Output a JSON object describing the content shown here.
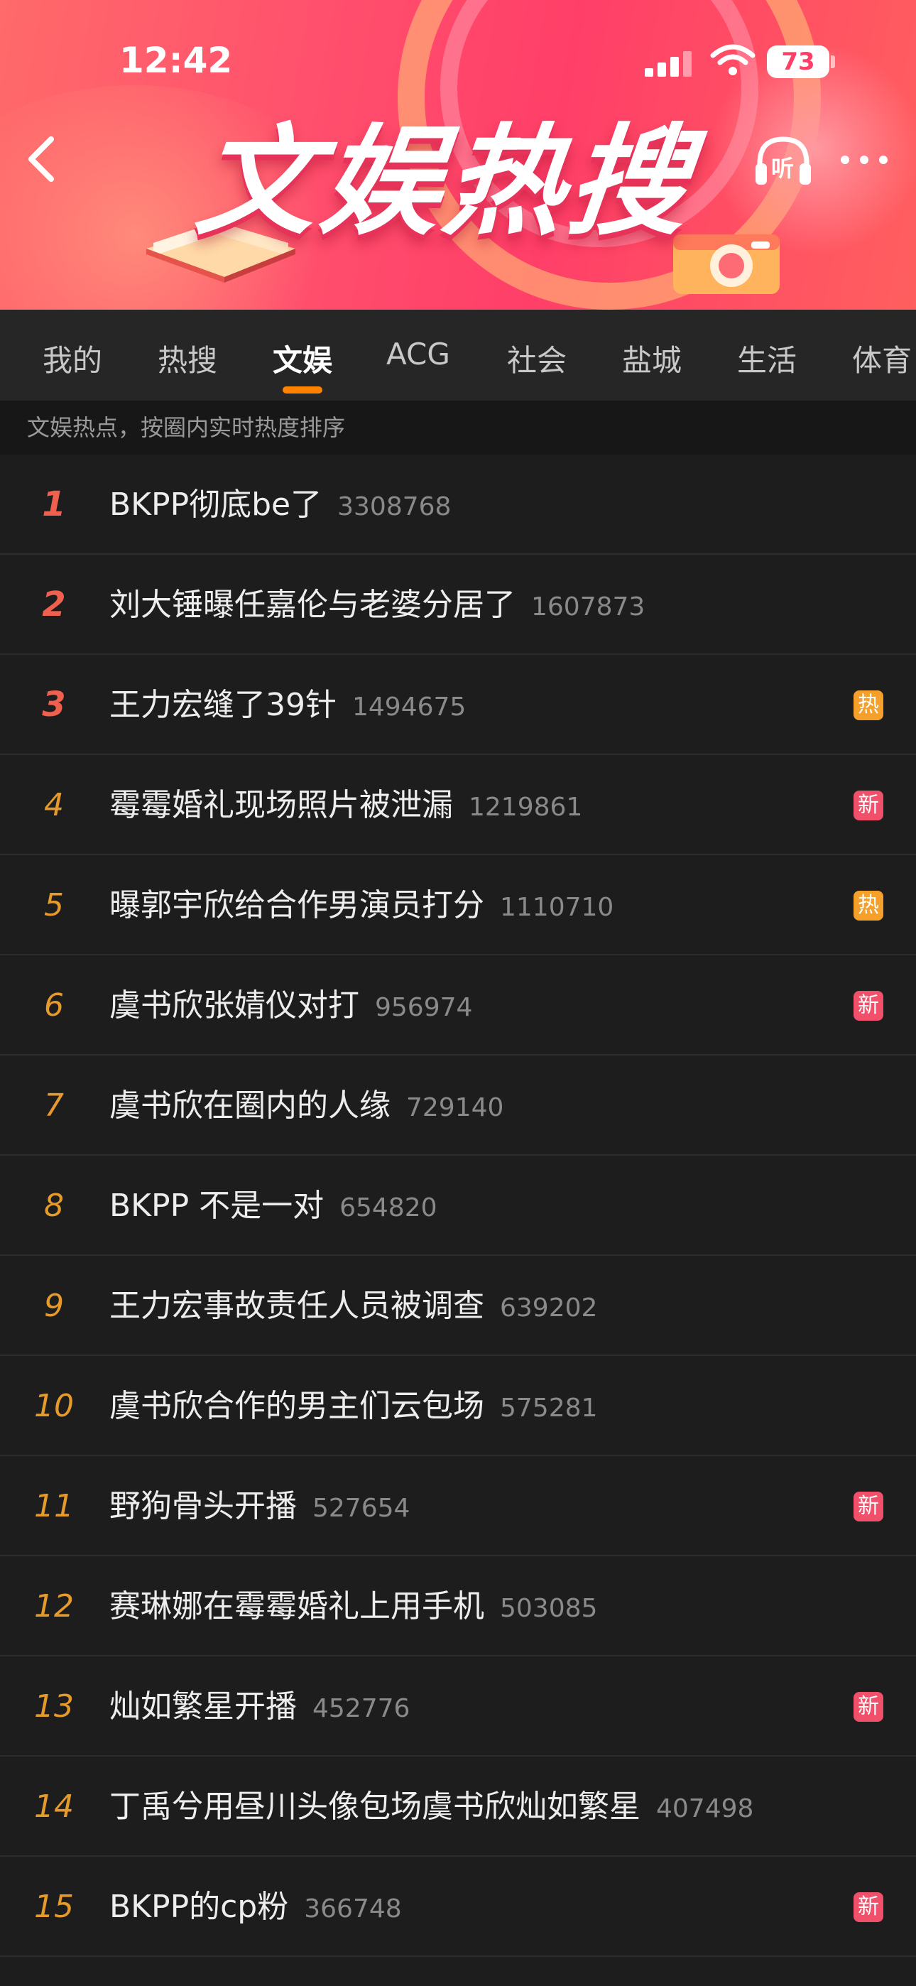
{
  "status_bar": {
    "time": "12:42",
    "battery": "73"
  },
  "header": {
    "title": "文娱热搜",
    "listen_label": "听"
  },
  "tabs": [
    {
      "label": "我的"
    },
    {
      "label": "热搜"
    },
    {
      "label": "文娱"
    },
    {
      "label": "ACG"
    },
    {
      "label": "社会"
    },
    {
      "label": "盐城"
    },
    {
      "label": "生活"
    },
    {
      "label": "体育"
    }
  ],
  "active_tab": "文娱",
  "subheader": "文娱热点，按圈内实时热度排序",
  "colors": {
    "accent": "#ff8200",
    "hot_badge": "#f5a02a",
    "new_badge": "#f0506a",
    "rank_top": "#f0604f",
    "rank": "#e69a2a"
  },
  "list": [
    {
      "rank": "1",
      "title": "BKPP彻底be了",
      "count": "3308768",
      "badge": ""
    },
    {
      "rank": "2",
      "title": "刘大锤曝任嘉伦与老婆分居了",
      "count": "1607873",
      "badge": ""
    },
    {
      "rank": "3",
      "title": "王力宏缝了39针",
      "count": "1494675",
      "badge": "热"
    },
    {
      "rank": "4",
      "title": "霉霉婚礼现场照片被泄漏",
      "count": "1219861",
      "badge": "新"
    },
    {
      "rank": "5",
      "title": "曝郭宇欣给合作男演员打分",
      "count": "1110710",
      "badge": "热"
    },
    {
      "rank": "6",
      "title": "虞书欣张婧仪对打",
      "count": "956974",
      "badge": "新"
    },
    {
      "rank": "7",
      "title": "虞书欣在圈内的人缘",
      "count": "729140",
      "badge": ""
    },
    {
      "rank": "8",
      "title": "BKPP 不是一对",
      "count": "654820",
      "badge": ""
    },
    {
      "rank": "9",
      "title": "王力宏事故责任人员被调查",
      "count": "639202",
      "badge": ""
    },
    {
      "rank": "10",
      "title": "虞书欣合作的男主们云包场",
      "count": "575281",
      "badge": ""
    },
    {
      "rank": "11",
      "title": "野狗骨头开播",
      "count": "527654",
      "badge": "新"
    },
    {
      "rank": "12",
      "title": "赛琳娜在霉霉婚礼上用手机",
      "count": "503085",
      "badge": ""
    },
    {
      "rank": "13",
      "title": "灿如繁星开播",
      "count": "452776",
      "badge": "新"
    },
    {
      "rank": "14",
      "title": "丁禹兮用昼川头像包场虞书欣灿如繁星",
      "count": "407498",
      "badge": ""
    },
    {
      "rank": "15",
      "title": "BKPP的cp粉",
      "count": "366748",
      "badge": "新"
    }
  ]
}
